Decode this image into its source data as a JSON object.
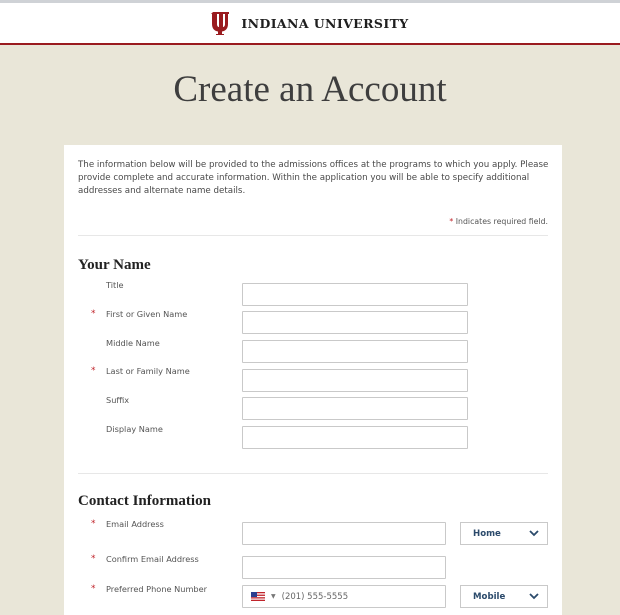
{
  "header": {
    "brand_name": "INDIANA UNIVERSITY",
    "accent_color": "#9a1b1f"
  },
  "page": {
    "title": "Create an Account"
  },
  "intro": {
    "text": "The information below will be provided to the admissions offices at the programs to which you apply. Please provide complete and accurate information. Within the application you will be able to specify additional addresses and alternate name details.",
    "required_star": "*",
    "required_note": "Indicates required field."
  },
  "name_section": {
    "title": "Your Name",
    "fields": [
      {
        "label": "Title",
        "required": false,
        "value": ""
      },
      {
        "label": "First or Given Name",
        "required": true,
        "value": ""
      },
      {
        "label": "Middle Name",
        "required": false,
        "value": ""
      },
      {
        "label": "Last or Family Name",
        "required": true,
        "value": ""
      },
      {
        "label": "Suffix",
        "required": false,
        "value": ""
      },
      {
        "label": "Display Name",
        "required": false,
        "value": ""
      }
    ]
  },
  "contact_section": {
    "title": "Contact Information",
    "email": {
      "label": "Email Address",
      "required": true,
      "value": "",
      "type_value": "Home"
    },
    "confirm_email": {
      "label": "Confirm Email Address",
      "required": true,
      "value": ""
    },
    "phone": {
      "label": "Preferred Phone Number",
      "required": true,
      "placeholder": "(201) 555-5555",
      "country_icon": "us-flag-icon",
      "type_value": "Mobile"
    }
  }
}
